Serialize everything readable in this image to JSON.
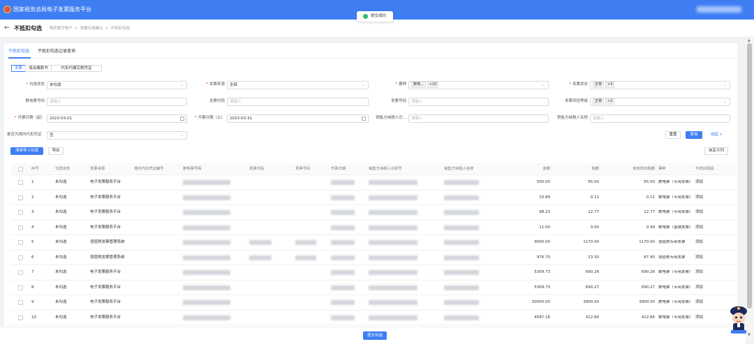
{
  "header": {
    "app_title": "国家税务总局电子发票服务平台",
    "toast": "提交成功"
  },
  "crumbbar": {
    "back": "←",
    "page_title": "不抵扣勾选",
    "breadcrumbs": [
      "税务数字账户",
      ">",
      "发票勾选确认",
      ">",
      "不抵扣勾选"
    ]
  },
  "tabs": [
    "不抵扣勾选",
    "不抵扣勾选记录查询"
  ],
  "segments": [
    "发票",
    "海关缴款书",
    "代扣代缴完税凭证"
  ],
  "filters": {
    "select_status_label": "勾选状态",
    "select_status_value": "未勾选",
    "source_label": "发票来源",
    "source_value": "全部",
    "ticket_label": "票种",
    "ticket_tag": "数电...",
    "ticket_more": "+10",
    "invoice_status_label": "发票状态",
    "invoice_status_tag": "正常",
    "invoice_status_more": "+3",
    "shudian_label": "数电票号码",
    "shudian_ph": "请输入",
    "code_label": "发票代码",
    "code_ph": "请输入",
    "number_label": "发票号码",
    "number_ph": "请输入",
    "risk_label": "发票风险等级",
    "risk_tag": "正常",
    "risk_more": "+2",
    "start_label": "开票日期（起）",
    "start_value": "2023-03-01",
    "end_label": "开票日期（止）",
    "end_value": "2023-03-31",
    "seller_id_label": "销售方纳税人识...",
    "seller_id_ph": "请输入",
    "seller_name_label": "销售方纳税人名称",
    "seller_name_ph": "请输入",
    "proxy_label": "是否为境内代扣凭证",
    "proxy_value": "否"
  },
  "actions": {
    "reset": "重置",
    "query": "查询",
    "collapse": "收起 ∧",
    "batch": "清单导入勾选",
    "export": "导出",
    "custom_cols": "自定义列"
  },
  "columns": [
    "序号",
    "勾选状态",
    "发票来源",
    "境内代扣凭证编号",
    "数电票号码",
    "发票代码",
    "发票号码",
    "开票日期",
    "销售方纳税人识别号",
    "销售方纳税人名称",
    "金额",
    "税额",
    "有效抵扣税额",
    "票种",
    "不抵扣原因"
  ],
  "rows": [
    {
      "no": "1",
      "status": "未勾选",
      "source": "电子发票服务平台",
      "amount": "500.00",
      "tax": "65.00",
      "valid": "65.00",
      "type": "数电票（专用发票）",
      "action": "添加",
      "has_code": false
    },
    {
      "no": "2",
      "status": "未勾选",
      "source": "电子发票服务平台",
      "amount": "10.89",
      "tax": "0.11",
      "valid": "0.11",
      "type": "数电票（专用发票）",
      "action": "添加",
      "has_code": false
    },
    {
      "no": "3",
      "status": "未勾选",
      "source": "电子发票服务平台",
      "amount": "98.23",
      "tax": "12.77",
      "valid": "12.77",
      "type": "数电票（专用发票）",
      "action": "添加",
      "has_code": false
    },
    {
      "no": "4",
      "status": "未勾选",
      "source": "电子发票服务平台",
      "amount": "11.00",
      "tax": "0.00",
      "valid": "0.99",
      "type": "数电票（普通发票）",
      "action": "添加",
      "has_code": false
    },
    {
      "no": "5",
      "status": "未勾选",
      "source": "增值税发票管理系统",
      "amount": "9000.00",
      "tax": "1170.00",
      "valid": "1170.00",
      "type": "增值税专用发票",
      "action": "添加",
      "has_code": true
    },
    {
      "no": "6",
      "status": "未勾选",
      "source": "增值税发票管理系统",
      "amount": "976.70",
      "tax": "23.30",
      "valid": "87.90",
      "type": "增值税专用发票",
      "action": "添加",
      "has_code": true
    },
    {
      "no": "7",
      "status": "未勾选",
      "source": "电子发票服务平台",
      "amount": "5309.73",
      "tax": "690.26",
      "valid": "690.26",
      "type": "数电票（专用发票）",
      "action": "添加",
      "has_code": false
    },
    {
      "no": "8",
      "status": "未勾选",
      "source": "电子发票服务平台",
      "amount": "5309.73",
      "tax": "690.27",
      "valid": "690.27",
      "type": "数电票（专用发票）",
      "action": "添加",
      "has_code": false
    },
    {
      "no": "9",
      "status": "未勾选",
      "source": "电子发票服务平台",
      "amount": "30000.00",
      "tax": "3900.00",
      "valid": "3900.00",
      "type": "数电票（专用发票）",
      "action": "添加",
      "has_code": false
    },
    {
      "no": "10",
      "status": "未勾选",
      "source": "电子发票服务平台",
      "amount": "4587.16",
      "tax": "412.84",
      "valid": "412.84",
      "type": "数电票（专用发票）",
      "action": "添加",
      "has_code": false
    }
  ],
  "footer": {
    "submit": "提交勾选"
  },
  "colors": {
    "accent": "#3e7ef2",
    "success": "#2ebd6c",
    "required": "#f5222d"
  }
}
